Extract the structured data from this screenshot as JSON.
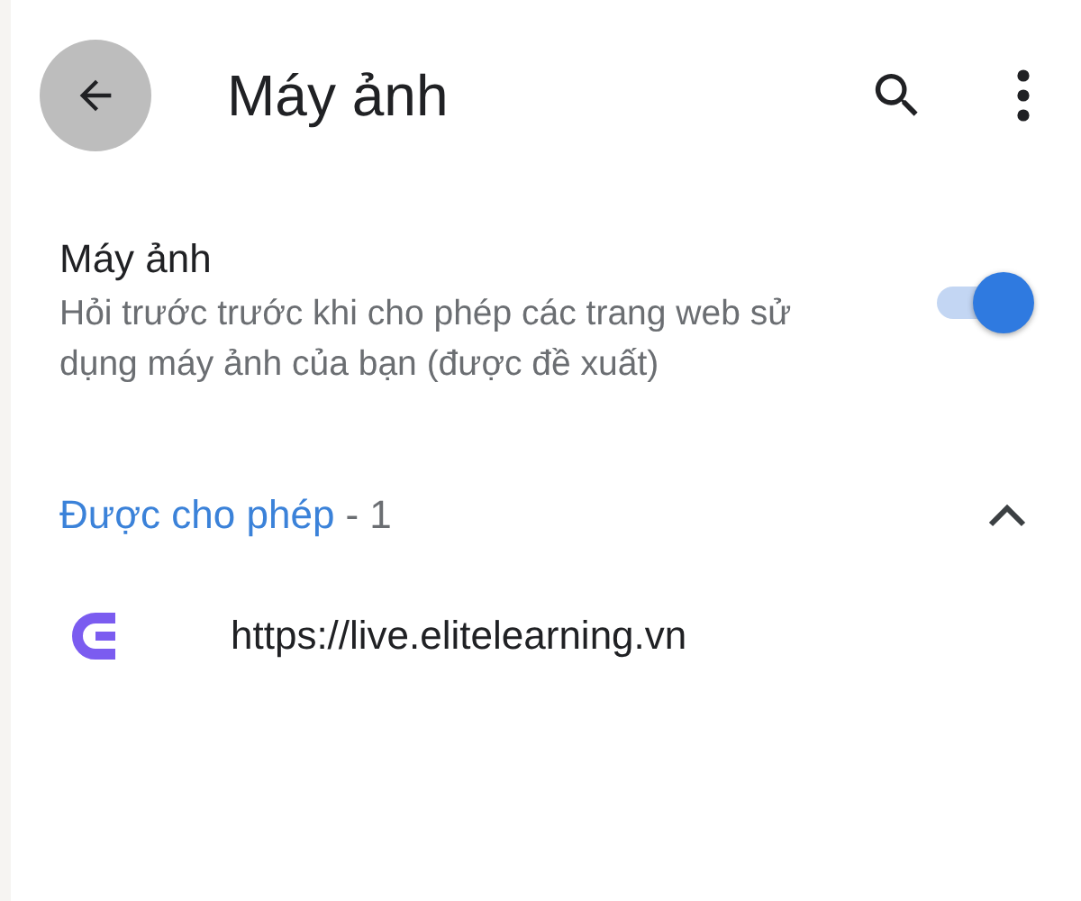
{
  "header": {
    "title": "Máy ảnh"
  },
  "setting": {
    "title": "Máy ảnh",
    "description": "Hỏi trước trước khi cho phép các trang web sử dụng máy ảnh của bạn (được đề xuất)",
    "on": true
  },
  "section": {
    "label": "Được cho phép",
    "count": "- 1",
    "expanded": true
  },
  "sites": [
    {
      "url": "https://live.elitelearning.vn"
    }
  ]
}
